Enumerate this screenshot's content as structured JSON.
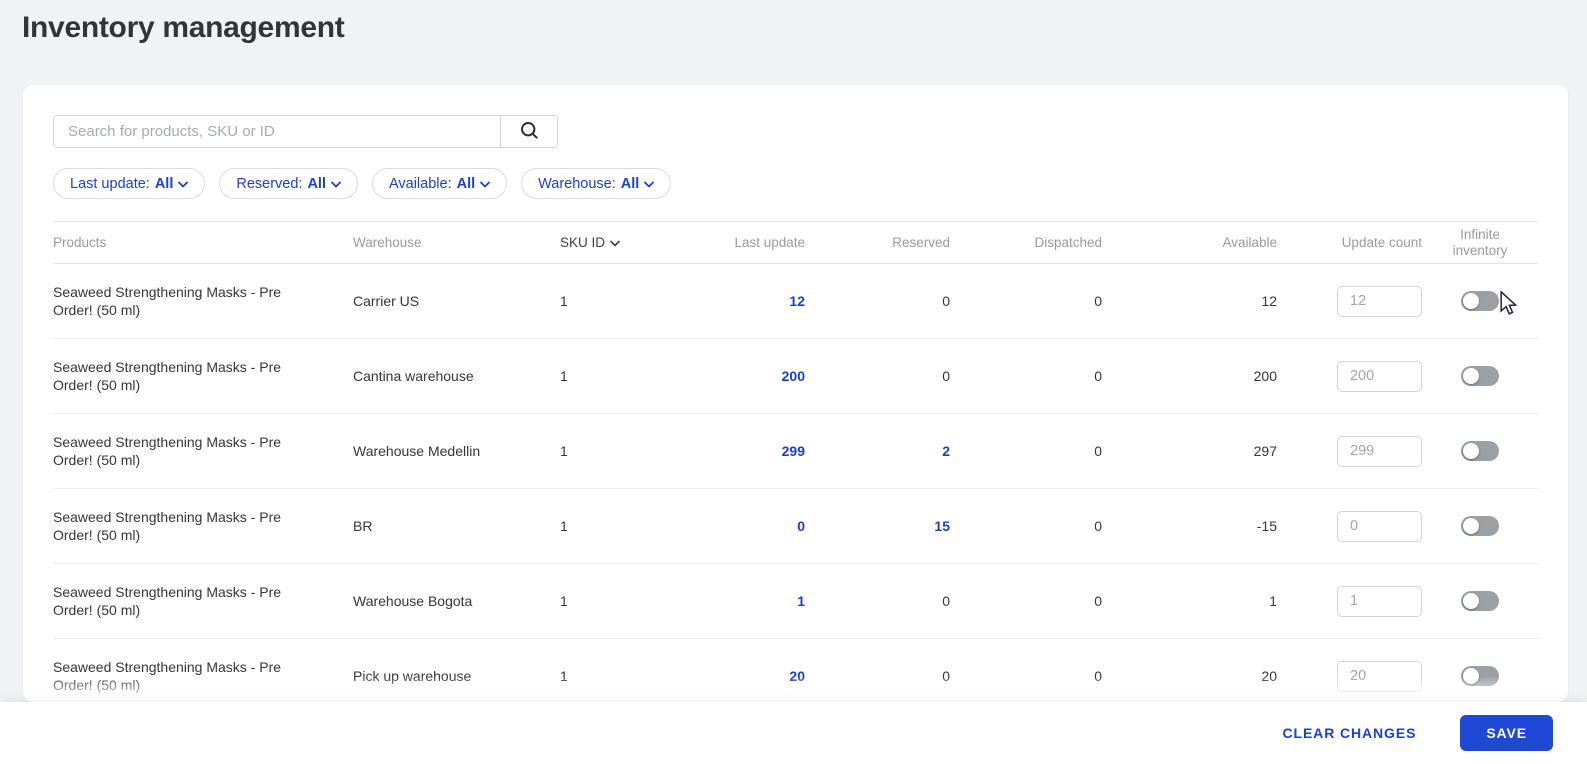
{
  "page": {
    "title": "Inventory management"
  },
  "search": {
    "placeholder": "Search for products, SKU or ID"
  },
  "filters": [
    {
      "label": "Last update:",
      "value": "All"
    },
    {
      "label": "Reserved:",
      "value": "All"
    },
    {
      "label": "Available:",
      "value": "All"
    },
    {
      "label": "Warehouse:",
      "value": "All"
    }
  ],
  "table": {
    "columns": [
      "Products",
      "Warehouse",
      "SKU ID",
      "Last update",
      "Reserved",
      "Dispatched",
      "Available",
      "Update count",
      "Infinite inventory"
    ],
    "sorted_by": "SKU ID",
    "rows": [
      {
        "product": "Seaweed Strengthening Masks - Pre Order! (50 ml)",
        "warehouse": "Carrier US",
        "sku": "1",
        "last_update": "12",
        "reserved": "0",
        "reserved_blue": false,
        "dispatched": "0",
        "available": "12",
        "update_count": "12",
        "infinite": false
      },
      {
        "product": "Seaweed Strengthening Masks - Pre Order! (50 ml)",
        "warehouse": "Cantina warehouse",
        "sku": "1",
        "last_update": "200",
        "reserved": "0",
        "reserved_blue": false,
        "dispatched": "0",
        "available": "200",
        "update_count": "200",
        "infinite": false
      },
      {
        "product": "Seaweed Strengthening Masks - Pre Order! (50 ml)",
        "warehouse": "Warehouse Medellin",
        "sku": "1",
        "last_update": "299",
        "reserved": "2",
        "reserved_blue": true,
        "dispatched": "0",
        "available": "297",
        "update_count": "299",
        "infinite": false
      },
      {
        "product": "Seaweed Strengthening Masks - Pre Order! (50 ml)",
        "warehouse": "BR",
        "sku": "1",
        "last_update": "0",
        "reserved": "15",
        "reserved_blue": true,
        "dispatched": "0",
        "available": "-15",
        "update_count": "0",
        "infinite": false
      },
      {
        "product": "Seaweed Strengthening Masks - Pre Order! (50 ml)",
        "warehouse": "Warehouse Bogota",
        "sku": "1",
        "last_update": "1",
        "reserved": "0",
        "reserved_blue": false,
        "dispatched": "0",
        "available": "1",
        "update_count": "1",
        "infinite": false
      },
      {
        "product": "Seaweed Strengthening Masks - Pre Order! (50 ml)",
        "warehouse": "Pick up warehouse",
        "sku": "1",
        "last_update": "20",
        "reserved": "0",
        "reserved_blue": false,
        "dispatched": "0",
        "available": "20",
        "update_count": "20",
        "infinite": false
      }
    ]
  },
  "footer": {
    "clear_changes": "CLEAR CHANGES",
    "save": "SAVE"
  },
  "colors": {
    "accent_blue": "#1c40d3",
    "save_button_blue": "#1d49d6",
    "page_background": "#f0f2f4",
    "header_text_gray": "#9b9b9b",
    "toggle_off_gray": "#9ba0a5"
  }
}
